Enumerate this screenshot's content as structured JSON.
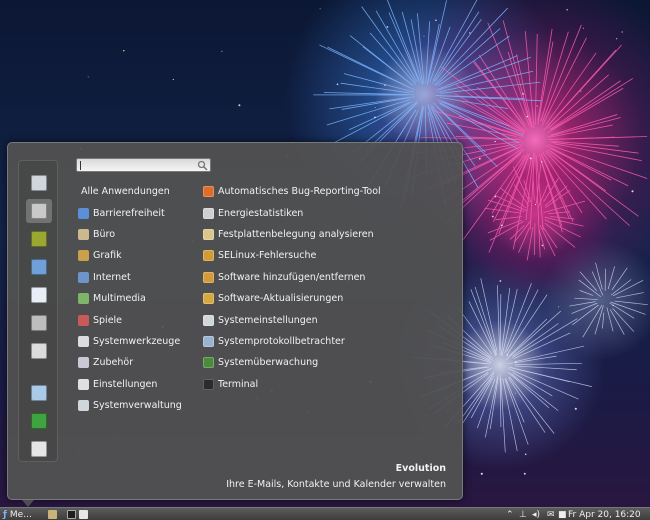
{
  "menu": {
    "search": {
      "value": "",
      "placeholder": ""
    },
    "favorites": [
      {
        "name": "tools-icon",
        "color": "#cfd6dc"
      },
      {
        "name": "network-icon",
        "color": "#c9c9c9"
      },
      {
        "name": "camera-icon",
        "color": "#9aa832"
      },
      {
        "name": "monitor-icon",
        "color": "#6fa0d8"
      },
      {
        "name": "document-icon",
        "color": "#e8eef5"
      },
      {
        "name": "archive-icon",
        "color": "#bdbdbd"
      },
      {
        "name": "doctor-icon",
        "color": "#dcdcdc"
      },
      {
        "name": "screen-lock-icon",
        "color": "#a9cbe8"
      },
      {
        "name": "logout-icon",
        "color": "#3fa33f"
      },
      {
        "name": "shutdown-icon",
        "color": "#e6e6e6"
      }
    ],
    "categories": [
      {
        "label": "Alle Anwendungen",
        "icon": "",
        "color": ""
      },
      {
        "label": "Barrierefreiheit",
        "icon": "accessibility-icon",
        "color": "#5b8fd6"
      },
      {
        "label": "Büro",
        "icon": "office-icon",
        "color": "#cdb890"
      },
      {
        "label": "Grafik",
        "icon": "graphics-icon",
        "color": "#c9a04b"
      },
      {
        "label": "Internet",
        "icon": "globe-icon",
        "color": "#6d95c9"
      },
      {
        "label": "Multimedia",
        "icon": "multimedia-icon",
        "color": "#7fb567"
      },
      {
        "label": "Spiele",
        "icon": "games-icon",
        "color": "#c85a5a"
      },
      {
        "label": "Systemwerkzeuge",
        "icon": "gear-icon",
        "color": "#dcdcdc"
      },
      {
        "label": "Zubehör",
        "icon": "accessories-icon",
        "color": "#c9c9d6"
      },
      {
        "label": "Einstellungen",
        "icon": "settings-icon",
        "color": "#e0e0e0"
      },
      {
        "label": "Systemverwaltung",
        "icon": "admin-icon",
        "color": "#cfd6dc"
      }
    ],
    "apps": [
      {
        "label": "Automatisches Bug-Reporting-Tool",
        "icon": "bug-icon",
        "color": "#e06d2b"
      },
      {
        "label": "Energiestatistiken",
        "icon": "power-icon",
        "color": "#d0d0d0"
      },
      {
        "label": "Festplattenbelegung analysieren",
        "icon": "disk-icon",
        "color": "#dbc58a"
      },
      {
        "label": "SELinux-Fehlersuche",
        "icon": "selinux-icon",
        "color": "#d39a3a"
      },
      {
        "label": "Software hinzufügen/entfernen",
        "icon": "package-icon",
        "color": "#d59a3b"
      },
      {
        "label": "Software-Aktualisierungen",
        "icon": "update-icon",
        "color": "#d6a840"
      },
      {
        "label": "Systemeinstellungen",
        "icon": "system-settings-icon",
        "color": "#cfd6dc"
      },
      {
        "label": "Systemprotokollbetrachter",
        "icon": "log-icon",
        "color": "#9ab3d2"
      },
      {
        "label": "Systemüberwachung",
        "icon": "monitor-icon",
        "color": "#4c8a3c"
      },
      {
        "label": "Terminal",
        "icon": "terminal-icon",
        "color": "#2b2b2b"
      }
    ],
    "description": {
      "title": "Evolution",
      "text": "Ihre E-Mails, Kontakte und Kalender verwalten"
    }
  },
  "taskbar": {
    "menu_label": "Me...",
    "clock": "Fr Apr 20, 16:20"
  },
  "colors": {
    "menu_bg": "#525252",
    "text": "#f2f2f2",
    "accent_pink": "#ff3d9a",
    "accent_blue": "#3c7be0"
  }
}
